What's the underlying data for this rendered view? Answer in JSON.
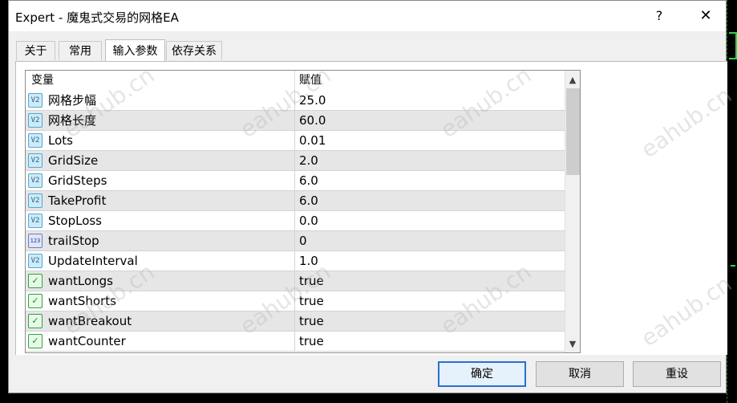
{
  "window": {
    "title": "Expert - 魔鬼式交易的网格EA",
    "help_label": "?",
    "close_label": "✕"
  },
  "tabs": [
    {
      "label": "关于"
    },
    {
      "label": "常用"
    },
    {
      "label": "输入参数"
    },
    {
      "label": "依存关系"
    }
  ],
  "table": {
    "header": {
      "variable": "变量",
      "value": "赋值"
    },
    "rows": [
      {
        "icon": "v2",
        "name": "网格步幅",
        "value": "25.0"
      },
      {
        "icon": "v2",
        "name": "网格长度",
        "value": "60.0"
      },
      {
        "icon": "v2",
        "name": "Lots",
        "value": "0.01"
      },
      {
        "icon": "v2",
        "name": "GridSize",
        "value": "2.0"
      },
      {
        "icon": "v2",
        "name": "GridSteps",
        "value": "6.0"
      },
      {
        "icon": "v2",
        "name": "TakeProfit",
        "value": "6.0"
      },
      {
        "icon": "v2",
        "name": "StopLoss",
        "value": "0.0"
      },
      {
        "icon": "123",
        "name": "trailStop",
        "value": "0"
      },
      {
        "icon": "v2",
        "name": "UpdateInterval",
        "value": "1.0"
      },
      {
        "icon": "bool",
        "name": "wantLongs",
        "value": "true"
      },
      {
        "icon": "bool",
        "name": "wantShorts",
        "value": "true"
      },
      {
        "icon": "bool",
        "name": "wantBreakout",
        "value": "true"
      },
      {
        "icon": "bool",
        "name": "wantCounter",
        "value": "true"
      }
    ]
  },
  "icons": {
    "v2": {
      "glyph": "V2",
      "name": "double-value-icon"
    },
    "123": {
      "glyph": "123",
      "name": "integer-value-icon"
    },
    "bool": {
      "glyph": "✓",
      "name": "boolean-value-icon"
    }
  },
  "scroll": {
    "up": "▲",
    "down": "▼"
  },
  "buttons": {
    "ok": "确定",
    "cancel": "取消",
    "reset": "重设"
  },
  "watermark": "eahub.cn",
  "colors": {
    "primary_border": "#2a6fd1",
    "row_alt": "#e6e6e6",
    "chart_green": "#31d14a"
  }
}
